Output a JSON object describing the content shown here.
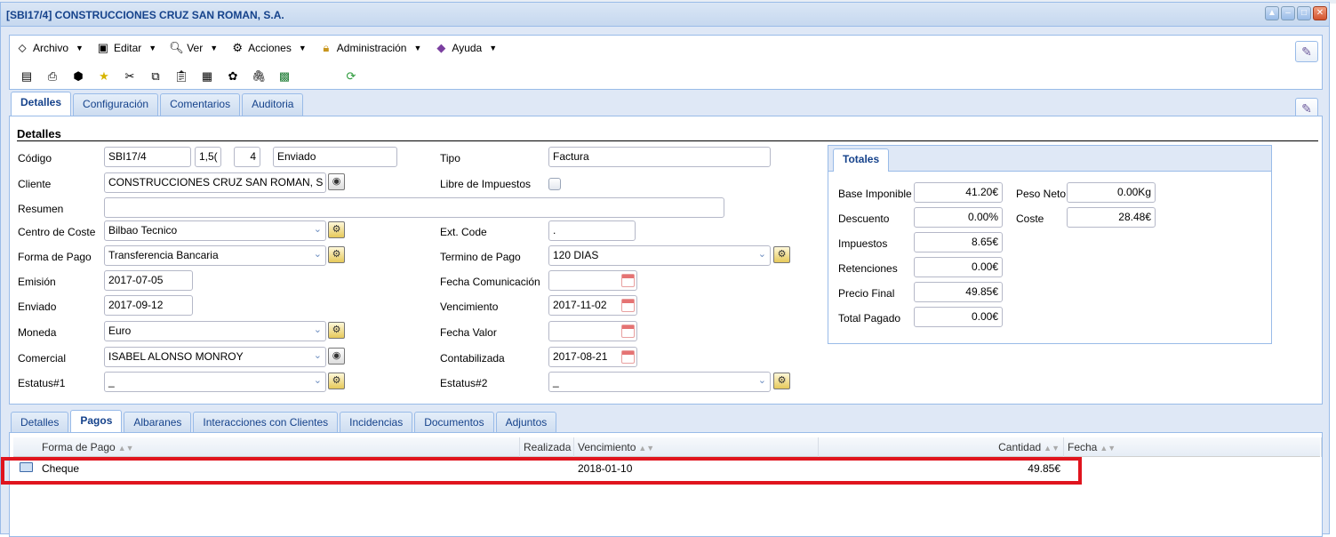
{
  "window": {
    "title": "[SBI17/4] CONSTRUCCIONES CRUZ SAN ROMAN, S.A."
  },
  "menu": [
    {
      "label": "Archivo",
      "icon": "archive-icon"
    },
    {
      "label": "Editar",
      "icon": "edit-icon"
    },
    {
      "label": "Ver",
      "icon": "view-icon"
    },
    {
      "label": "Acciones",
      "icon": "actions-icon"
    },
    {
      "label": "Administración",
      "icon": "lock-icon"
    },
    {
      "label": "Ayuda",
      "icon": "help-book-icon"
    }
  ],
  "toolbar_icons": [
    "save-icon",
    "print-icon",
    "delete-icon",
    "favorite-star-icon",
    "cut-icon",
    "copy-icon",
    "paste-icon",
    "report-icon",
    "settings-icon",
    "attach-icon",
    "excel-icon",
    "refresh-icon"
  ],
  "main_tabs": [
    "Detalles",
    "Configuración",
    "Comentarios",
    "Auditoria"
  ],
  "section_title": "Detalles",
  "form": {
    "codigo_label": "Código",
    "codigo": "SBI17/4",
    "codigo_extra": "1,5(",
    "codigo_num": "4",
    "estado": "Enviado",
    "tipo_label": "Tipo",
    "tipo": "Factura",
    "cliente_label": "Cliente",
    "cliente": "CONSTRUCCIONES CRUZ SAN ROMAN, S",
    "libre_label": "Libre de Impuestos",
    "resumen_label": "Resumen",
    "resumen": "",
    "centro_label": "Centro de Coste",
    "centro": "Bilbao Tecnico",
    "ext_label": "Ext. Code",
    "ext": ".",
    "forma_label": "Forma de Pago",
    "forma": "Transferencia Bancaria",
    "termino_label": "Termino de Pago",
    "termino": "120 DIAS",
    "emision_label": "Emisión",
    "emision": "2017-07-05",
    "fecha_com_label": "Fecha Comunicación",
    "fecha_com": "",
    "enviado_label": "Enviado",
    "enviado": "2017-09-12",
    "vencimiento_label": "Vencimiento",
    "vencimiento": "2017-11-02",
    "moneda_label": "Moneda",
    "moneda": "Euro",
    "fecha_valor_label": "Fecha Valor",
    "fecha_valor": "",
    "comercial_label": "Comercial",
    "comercial": "ISABEL ALONSO MONROY",
    "contabilizada_label": "Contabilizada",
    "contabilizada": "2017-08-21",
    "estatus1_label": "Estatus#1",
    "estatus1": "_",
    "estatus2_label": "Estatus#2",
    "estatus2": "_"
  },
  "totales": {
    "tab": "Totales",
    "base_label": "Base Imponible",
    "base": "41.20€",
    "descuento_label": "Descuento",
    "descuento": "0.00%",
    "impuestos_label": "Impuestos",
    "impuestos": "8.65€",
    "retenciones_label": "Retenciones",
    "retenciones": "0.00€",
    "precio_label": "Precio Final",
    "precio": "49.85€",
    "pagado_label": "Total Pagado",
    "pagado": "0.00€",
    "peso_label": "Peso Neto",
    "peso": "0.00Kg",
    "coste_label": "Coste",
    "coste": "28.48€"
  },
  "lower_tabs": [
    "Detalles",
    "Pagos",
    "Albaranes",
    "Interacciones con Clientes",
    "Incidencias",
    "Documentos",
    "Adjuntos"
  ],
  "grid": {
    "columns": [
      "Forma de Pago",
      "Realizada",
      "Vencimiento",
      "Cantidad",
      "Fecha"
    ],
    "rows": [
      {
        "forma": "Cheque",
        "realizada": "",
        "vencimiento": "2018-01-10",
        "cantidad": "49.85€",
        "fecha": ""
      }
    ]
  }
}
